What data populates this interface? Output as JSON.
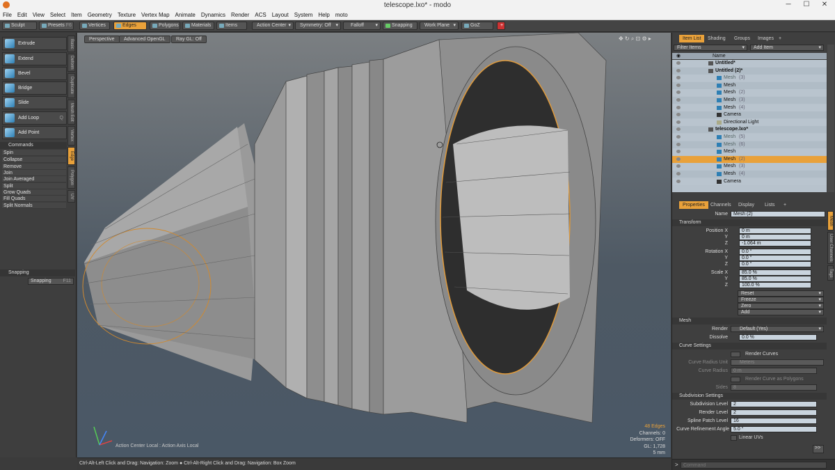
{
  "window": {
    "title": "telescope.lxo* - modo",
    "minimize": "─",
    "maximize": "☐",
    "close": "✕"
  },
  "menu": [
    "File",
    "Edit",
    "View",
    "Select",
    "Item",
    "Geometry",
    "Texture",
    "Vertex Map",
    "Animate",
    "Dynamics",
    "Render",
    "ACS",
    "Layout",
    "System",
    "Help",
    "moto"
  ],
  "toolbar": {
    "sculpt": "Sculpt",
    "presets": "Presets",
    "presets_key": "F6",
    "vertices": "Vertices",
    "edges": "Edges",
    "polygons": "Polygons",
    "materials": "Materials",
    "items": "Items",
    "action_center": "Action Center",
    "symmetry": "Symmetry: Off",
    "falloff": "Falloff",
    "snapping": "Snapping",
    "work_plane": "Work Plane",
    "goz": "GoZ",
    "plus": "+"
  },
  "left": {
    "tools": [
      "Extrude",
      "Extend",
      "Bevel",
      "Bridge",
      "Slide",
      "Add Loop",
      "Add Point"
    ],
    "add_loop_key": "Q",
    "vtabs": [
      "Basic",
      "Deform",
      "Duplicate",
      "Mesh Edit",
      "Vertex",
      "Edge",
      "Polygon",
      "UV"
    ],
    "commands_header": "Commands",
    "commands": [
      "Spin",
      "Collapse",
      "Remove",
      "Join",
      "Join Averaged",
      "Split",
      "Grow Quads",
      "Fill Quads",
      "Split Normals"
    ],
    "snapping_header": "Snapping",
    "snapping_label": "Snapping",
    "snapping_key": "F11"
  },
  "viewport": {
    "perspective": "Perspective",
    "opengl": "Advanced OpenGL",
    "raygl": "Ray GL: Off",
    "hud": [
      "48 Edges",
      "Channels: 0",
      "Deformers: OFF",
      "GL: 1,728",
      "5 mm"
    ],
    "action_center": "Action Center Local : Action Axis Local"
  },
  "status": "Ctrl-Alt-Left Click and Drag: Navigation: Zoom ● Ctrl-Alt-Right Click and Drag: Navigation: Box Zoom",
  "itemlist": {
    "tabs": [
      "Item List",
      "Shading",
      "Groups",
      "Images",
      "+"
    ],
    "filter": "Filter Items",
    "add_item": "Add Item",
    "name_col": "Name",
    "rows": [
      {
        "name": "Untitled*",
        "kind": "scene",
        "sel": false,
        "dim": false
      },
      {
        "name": "Untitled (2)*",
        "kind": "scene",
        "sel": false,
        "dim": false
      },
      {
        "name": "Mesh",
        "suffix": "(3)",
        "kind": "mesh",
        "sel": false,
        "dim": true
      },
      {
        "name": "Mesh",
        "suffix": "",
        "kind": "mesh",
        "sel": false,
        "dim": false
      },
      {
        "name": "Mesh",
        "suffix": "(2)",
        "kind": "mesh",
        "sel": false,
        "dim": false
      },
      {
        "name": "Mesh",
        "suffix": "(3)",
        "kind": "mesh",
        "sel": false,
        "dim": false
      },
      {
        "name": "Mesh",
        "suffix": "(4)",
        "kind": "mesh",
        "sel": false,
        "dim": false
      },
      {
        "name": "Camera",
        "suffix": "",
        "kind": "camera",
        "sel": false,
        "dim": false
      },
      {
        "name": "Directional Light",
        "suffix": "",
        "kind": "light",
        "sel": false,
        "dim": false
      },
      {
        "name": "telescope.lxo*",
        "kind": "scene",
        "sel": false,
        "dim": false
      },
      {
        "name": "Mesh",
        "suffix": "(5)",
        "kind": "mesh",
        "sel": false,
        "dim": true
      },
      {
        "name": "Mesh",
        "suffix": "(6)",
        "kind": "mesh",
        "sel": false,
        "dim": true
      },
      {
        "name": "Mesh",
        "suffix": "",
        "kind": "mesh",
        "sel": false,
        "dim": false
      },
      {
        "name": "Mesh",
        "suffix": "(2)",
        "kind": "mesh",
        "sel": true,
        "dim": false
      },
      {
        "name": "Mesh",
        "suffix": "(3)",
        "kind": "mesh",
        "sel": false,
        "dim": false
      },
      {
        "name": "Mesh",
        "suffix": "(4)",
        "kind": "mesh",
        "sel": false,
        "dim": false
      },
      {
        "name": "Camera",
        "suffix": "",
        "kind": "camera",
        "sel": false,
        "dim": false
      }
    ]
  },
  "props": {
    "tabs": [
      "Properties",
      "Channels",
      "Display",
      "Lists",
      "+"
    ],
    "side_tabs": [
      "Mesh",
      "User Channels",
      "Tags"
    ],
    "name_label": "Name",
    "name_value": "Mesh (2)",
    "transform": "Transform",
    "position_x_label": "Position X",
    "position_x": "0 m",
    "position_y": "0 m",
    "position_z": "-1.064 m",
    "rotation_x_label": "Rotation X",
    "rotation_x": "0.0 °",
    "rotation_y": "0.0 °",
    "rotation_z": "0.0 °",
    "scale_x_label": "Scale X",
    "scale_x": "85.0 %",
    "scale_y": "85.0 %",
    "scale_z": "100.0 %",
    "y": "Y",
    "z": "Z",
    "reset": "Reset",
    "freeze": "Freeze",
    "zero": "Zero",
    "add": "Add",
    "mesh": "Mesh",
    "render_label": "Render",
    "render_value": "Default (Yes)",
    "dissolve_label": "Dissolve",
    "dissolve_value": "0.0 %",
    "curve_settings": "Curve Settings",
    "render_curves": "Render Curves",
    "curve_radius_unit_label": "Curve Radius Unit",
    "curve_radius_unit": "Meters",
    "curve_radius_label": "Curve Radius",
    "curve_radius": "0 m",
    "render_as_polys": "Render Curve as Polygons",
    "sides_label": "Sides",
    "sides": "8",
    "subdivision_settings": "Subdivision Settings",
    "subdiv_level_label": "Subdivision Level",
    "subdiv_level": "2",
    "render_level_label": "Render Level",
    "render_level": "2",
    "spline_label": "Spline Patch Level",
    "spline": "16",
    "curve_angle_label": "Curve Refinement Angle",
    "curve_angle": "5.0 °",
    "linear_uvs": "Linear UVs",
    "command_placeholder": "Command",
    "expand": ">>"
  }
}
